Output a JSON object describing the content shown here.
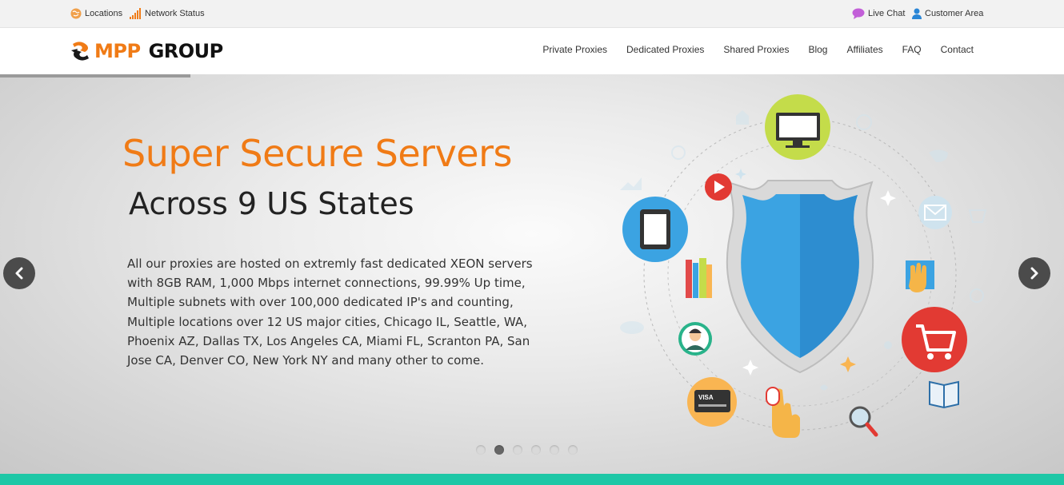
{
  "topbar": {
    "locations": "Locations",
    "network_status": "Network Status",
    "live_chat": "Live Chat",
    "customer_area": "Customer Area"
  },
  "logo": {
    "mpp": "MPP",
    "group": "GROUP"
  },
  "nav": {
    "items": [
      "Private Proxies",
      "Dedicated Proxies",
      "Shared Proxies",
      "Blog",
      "Affiliates",
      "FAQ",
      "Contact"
    ]
  },
  "hero": {
    "title": "Super Secure Servers",
    "subtitle": "Across 9 US States",
    "description": "All our proxies are hosted on extremly fast dedicated XEON servers with 8GB RAM, 1,000 Mbps internet connections, 99.99% Up time, Multiple subnets with over 100,000 dedicated IP's and counting, Multiple locations over 12 US major cities, Chicago IL, Seattle, WA, Phoenix AZ, Dallas TX, Los Angeles CA, Miami FL, Scranton PA, San Jose CA, Denver CO, New York NY and many other to come.",
    "card_label": "VISA",
    "slide_count": 6,
    "active_slide": 2
  },
  "colors": {
    "accent": "#f07b16",
    "shield": "#3ba3e2",
    "bottom_bar": "#1ec7a6"
  },
  "icons": {
    "prev": "chevron-left-icon",
    "next": "chevron-right-icon",
    "locations": "globe-icon",
    "network": "signal-bars-icon",
    "chat": "chat-bubble-icon",
    "user": "user-icon"
  }
}
